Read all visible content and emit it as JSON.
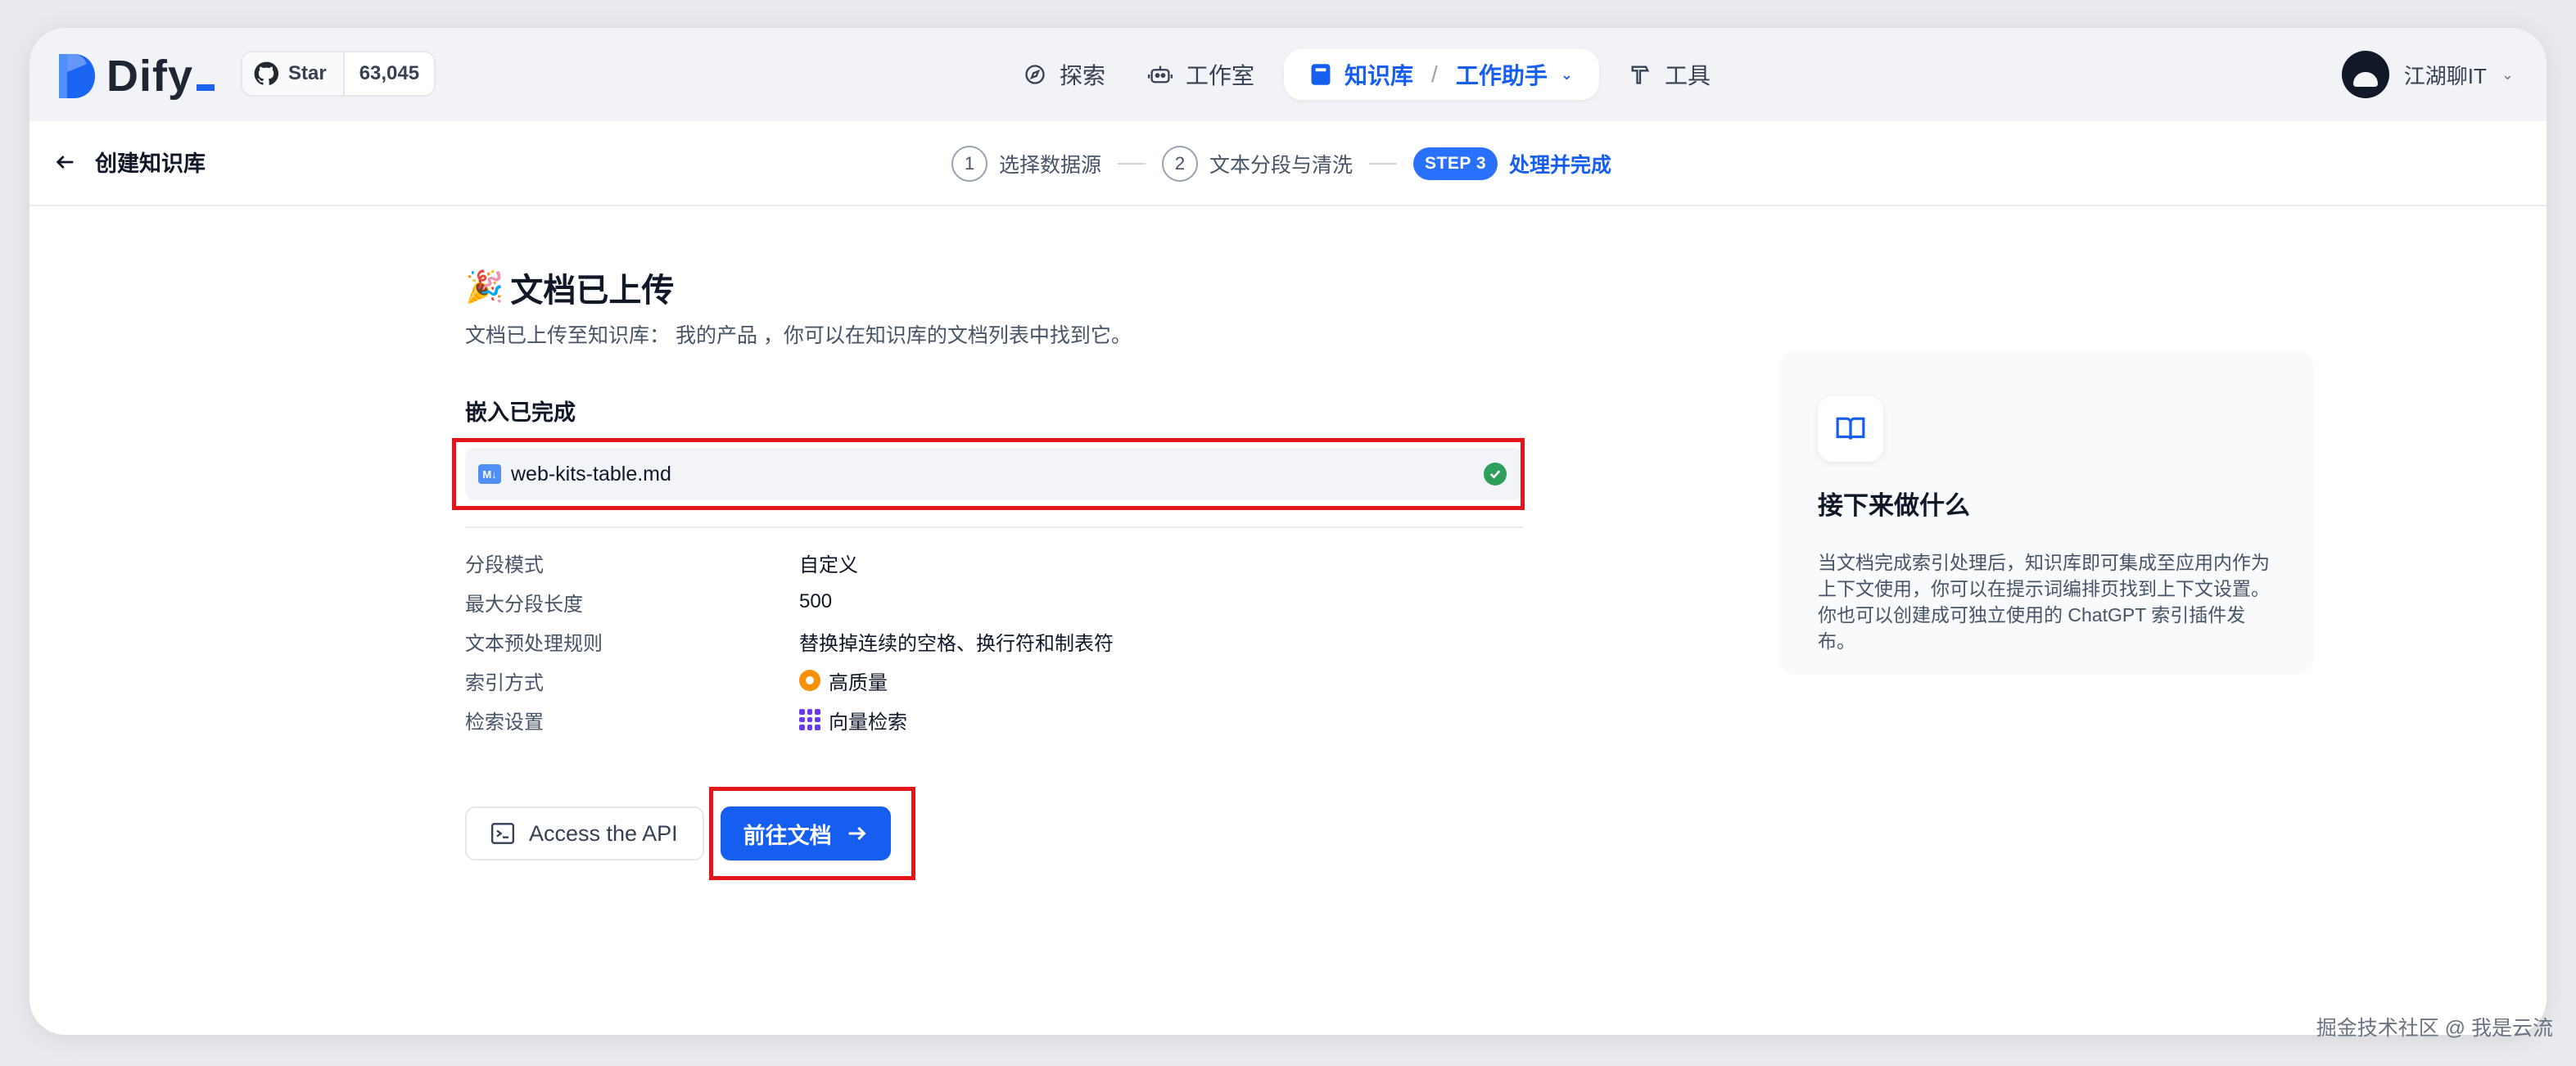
{
  "brand": {
    "name": "Dify"
  },
  "github": {
    "star_label": "Star",
    "count": "63,045"
  },
  "nav": {
    "items": [
      {
        "label": "探索"
      },
      {
        "label": "工作室"
      },
      {
        "label": "知识库",
        "sub_label": "工作助手"
      },
      {
        "label": "工具"
      }
    ]
  },
  "user": {
    "name": "江湖聊IT"
  },
  "subheader": {
    "back_label": "创建知识库",
    "steps": [
      {
        "num": "1",
        "label": "选择数据源"
      },
      {
        "num": "2",
        "label": "文本分段与清洗"
      },
      {
        "num": "STEP 3",
        "label": "处理并完成"
      }
    ]
  },
  "main": {
    "title_emoji": "🎉",
    "title": "文档已上传",
    "desc": "文档已上传至知识库： 我的产品 ，你可以在知识库的文档列表中找到它。",
    "section_title": "嵌入已完成",
    "file": {
      "type_badge": "M↓",
      "name": "web-kits-table.md",
      "status": "completed"
    },
    "info": [
      {
        "key": "分段模式",
        "value": "自定义"
      },
      {
        "key": "最大分段长度",
        "value": "500"
      },
      {
        "key": "文本预处理规则",
        "value": "替换掉连续的空格、换行符和制表符"
      },
      {
        "key": "索引方式",
        "value": "高质量"
      },
      {
        "key": "检索设置",
        "value": "向量检索"
      }
    ],
    "actions": {
      "api_label": "Access the API",
      "primary_label": "前往文档"
    }
  },
  "side": {
    "title": "接下来做什么",
    "desc": "当文档完成索引处理后，知识库即可集成至应用内作为上下文使用，你可以在提示词编排页找到上下文设置。你也可以创建成可独立使用的 ChatGPT 索引插件发布。"
  },
  "watermark": "掘金技术社区 @ 我是云流",
  "colors": {
    "accent": "#155eef",
    "highlight": "#e3151a",
    "success": "#2e9e5b"
  }
}
